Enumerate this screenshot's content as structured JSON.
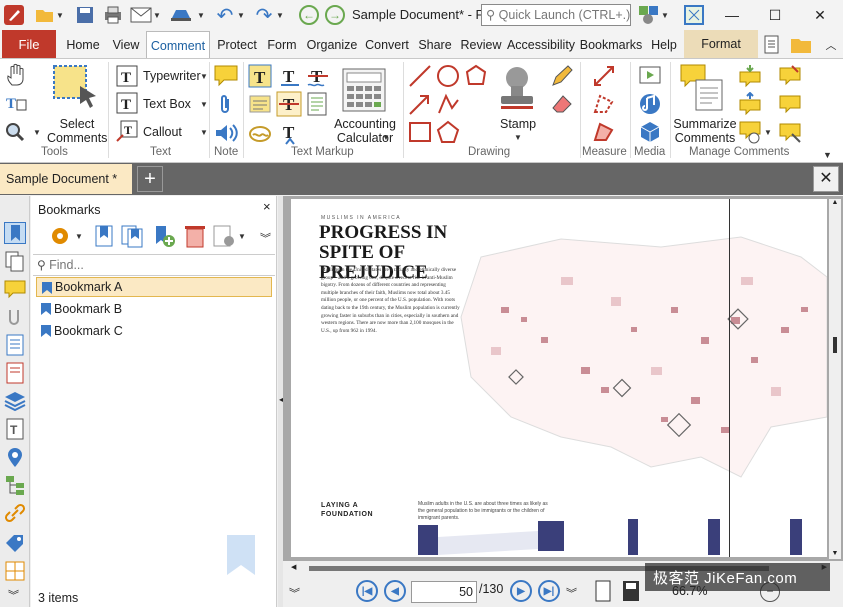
{
  "window": {
    "title": "Sample Document* - P...",
    "quick_launch_placeholder": "Quick Launch (CTRL+.)"
  },
  "tabs": [
    "File",
    "Home",
    "View",
    "Comment",
    "Protect",
    "Form",
    "Organize",
    "Convert",
    "Share",
    "Review",
    "Accessibility",
    "Bookmarks",
    "Help",
    "Format"
  ],
  "ribbon": {
    "select_comments": "Select Comments",
    "typewriter": "Typewriter",
    "text_box": "Text Box",
    "callout": "Callout",
    "accounting_calculator": "Accounting Calculator",
    "stamp": "Stamp",
    "summarize_comments": "Summarize Comments",
    "groups": {
      "tools": "Tools",
      "text": "Text",
      "note": "Note",
      "text_markup": "Text Markup",
      "drawing": "Drawing",
      "measure": "Measure",
      "media": "Media",
      "manage_comments": "Manage Comments"
    }
  },
  "document_tab": "Sample Document *",
  "bookmarks": {
    "title": "Bookmarks",
    "find_placeholder": "Find...",
    "items": [
      "Bookmark A",
      "Bookmark B",
      "Bookmark C"
    ],
    "count": "3 items"
  },
  "page_content": {
    "kicker": "MUSLIMS IN AMERICA",
    "headline": "PROGRESS IN SPITE OF PREJUDICE",
    "body": "Muslims in the United States are a racially and ethnically diverse group—and a growing one, despite a recent rise in anti-Muslim bigotry. From dozens of different countries and representing multiple branches of their faith, Muslims now total about 3.45 million people, or one percent of the U.S. population. With roots dating back to the 19th century, the Muslim population is currently growing faster in suburbs than in cities, especially in southern and western regions. There are now more than 2,100 mosques in the U.S., up from 962 in 1994.",
    "section": "LAYING A FOUNDATION",
    "section_body": "Muslim adults in the U.S. are about three times as likely as the general population to be immigrants or the children of immigrant parents."
  },
  "navigation": {
    "page": "50",
    "total": "/130",
    "zoom": "66.7%"
  },
  "watermark": "极客范 JiKeFan.com",
  "colors": {
    "file_tab": "#c0392b",
    "accent": "#1b5fa0",
    "format_tab": "#ecdcb8",
    "doc_tab": "#fbe9c4"
  }
}
